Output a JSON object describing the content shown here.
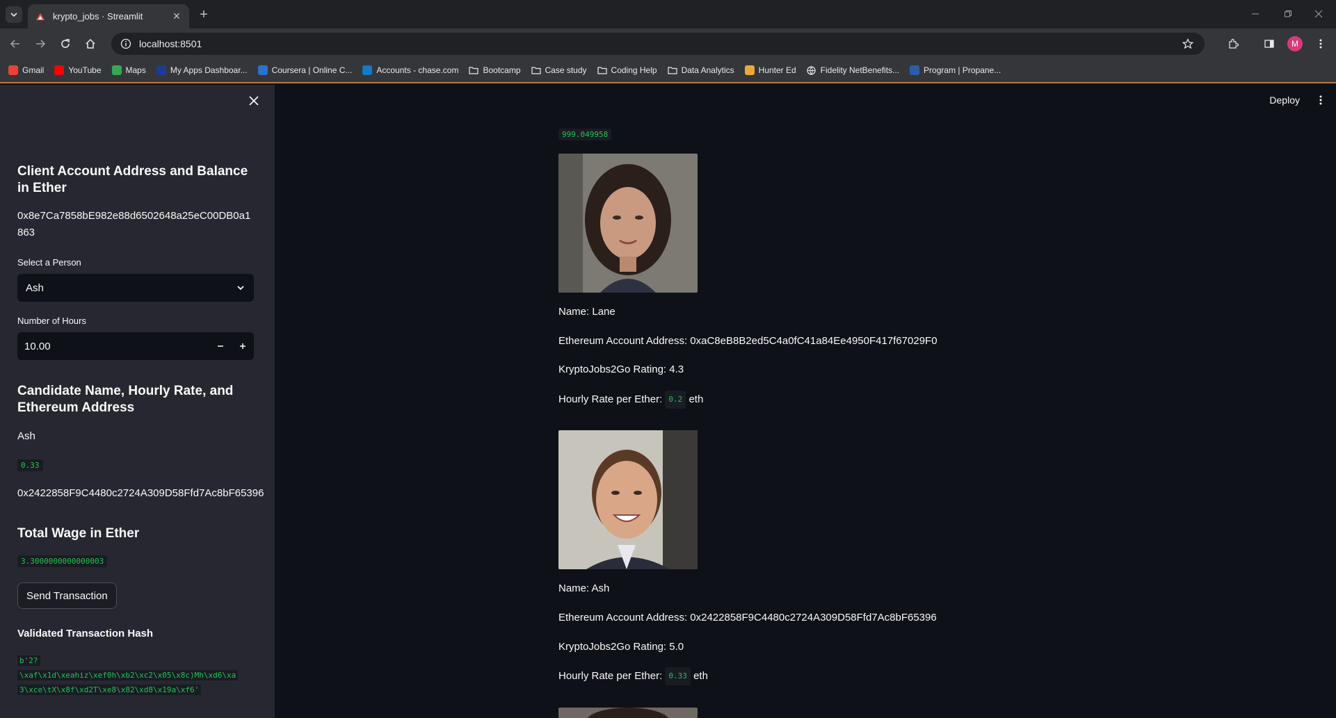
{
  "browser": {
    "tab_title": "krypto_jobs · Streamlit",
    "url": "localhost:8501",
    "profile_initial": "M",
    "bookmarks": [
      {
        "label": "Gmail",
        "icon": "gmail-icon",
        "color": "#ea4335"
      },
      {
        "label": "YouTube",
        "icon": "youtube-icon",
        "color": "#ff0000"
      },
      {
        "label": "Maps",
        "icon": "maps-icon",
        "color": "#34a853"
      },
      {
        "label": "My Apps Dashboar...",
        "icon": "apps-icon",
        "color": "#1a3d8f"
      },
      {
        "label": "Coursera | Online C...",
        "icon": "coursera-icon",
        "color": "#2a73cc"
      },
      {
        "label": "Accounts - chase.com",
        "icon": "chase-icon",
        "color": "#117aca"
      },
      {
        "label": "Bootcamp",
        "icon": "folder-icon",
        "color": ""
      },
      {
        "label": "Case study",
        "icon": "folder-icon",
        "color": ""
      },
      {
        "label": "Coding Help",
        "icon": "folder-icon",
        "color": ""
      },
      {
        "label": "Data Analytics",
        "icon": "folder-icon",
        "color": ""
      },
      {
        "label": "Hunter Ed",
        "icon": "hunter-icon",
        "color": "#e8a93a"
      },
      {
        "label": "Fidelity NetBenefits...",
        "icon": "globe-icon",
        "color": ""
      },
      {
        "label": "Program | Propane...",
        "icon": "program-icon",
        "color": "#2b5fa5"
      }
    ]
  },
  "app": {
    "deploy_label": "Deploy",
    "accent_green": "#21c354"
  },
  "sidebar": {
    "client_heading": "Client Account Address and Balance in Ether",
    "client_address": "0x8e7Ca7858bE982e88d6502648a25eC00DB0a1863",
    "select_label": "Select a Person",
    "selected_person": "Ash",
    "hours_label": "Number of Hours",
    "hours_value": "10.00",
    "candidate_heading": "Candidate Name, Hourly Rate, and Ethereum Address",
    "candidate_name": "Ash",
    "candidate_rate": "0.33",
    "candidate_address": "0x2422858F9C4480c2724A309D58Ffd7Ac8bF65396",
    "wage_heading": "Total Wage in Ether",
    "wage_value": "3.3000000000000003",
    "send_button": "Send Transaction",
    "hash_heading": "Validated Transaction Hash",
    "hash_lines": [
      "b'2?",
      "\\xaf\\x1d\\xeahiz\\xef0h\\xb2\\xc2\\x05\\x8c)Mh\\xd6\\xa",
      "3\\xce\\tX\\x8f\\xd2T\\xe8\\x82\\xd8\\x19a\\xf6'"
    ]
  },
  "main": {
    "balance": "999.049958",
    "candidates": [
      {
        "name_line": "Name: Lane",
        "address_line": "Ethereum Account Address: 0xaC8eB8B2ed5C4a0fC41a84Ee4950F417f67029F0",
        "rating_line": "KryptoJobs2Go Rating: 4.3",
        "rate_prefix": "Hourly Rate per Ether:",
        "rate": "0.2",
        "rate_suffix": "eth"
      },
      {
        "name_line": "Name: Ash",
        "address_line": "Ethereum Account Address: 0x2422858F9C4480c2724A309D58Ffd7Ac8bF65396",
        "rating_line": "KryptoJobs2Go Rating: 5.0",
        "rate_prefix": "Hourly Rate per Ether:",
        "rate": "0.33",
        "rate_suffix": "eth"
      }
    ]
  }
}
